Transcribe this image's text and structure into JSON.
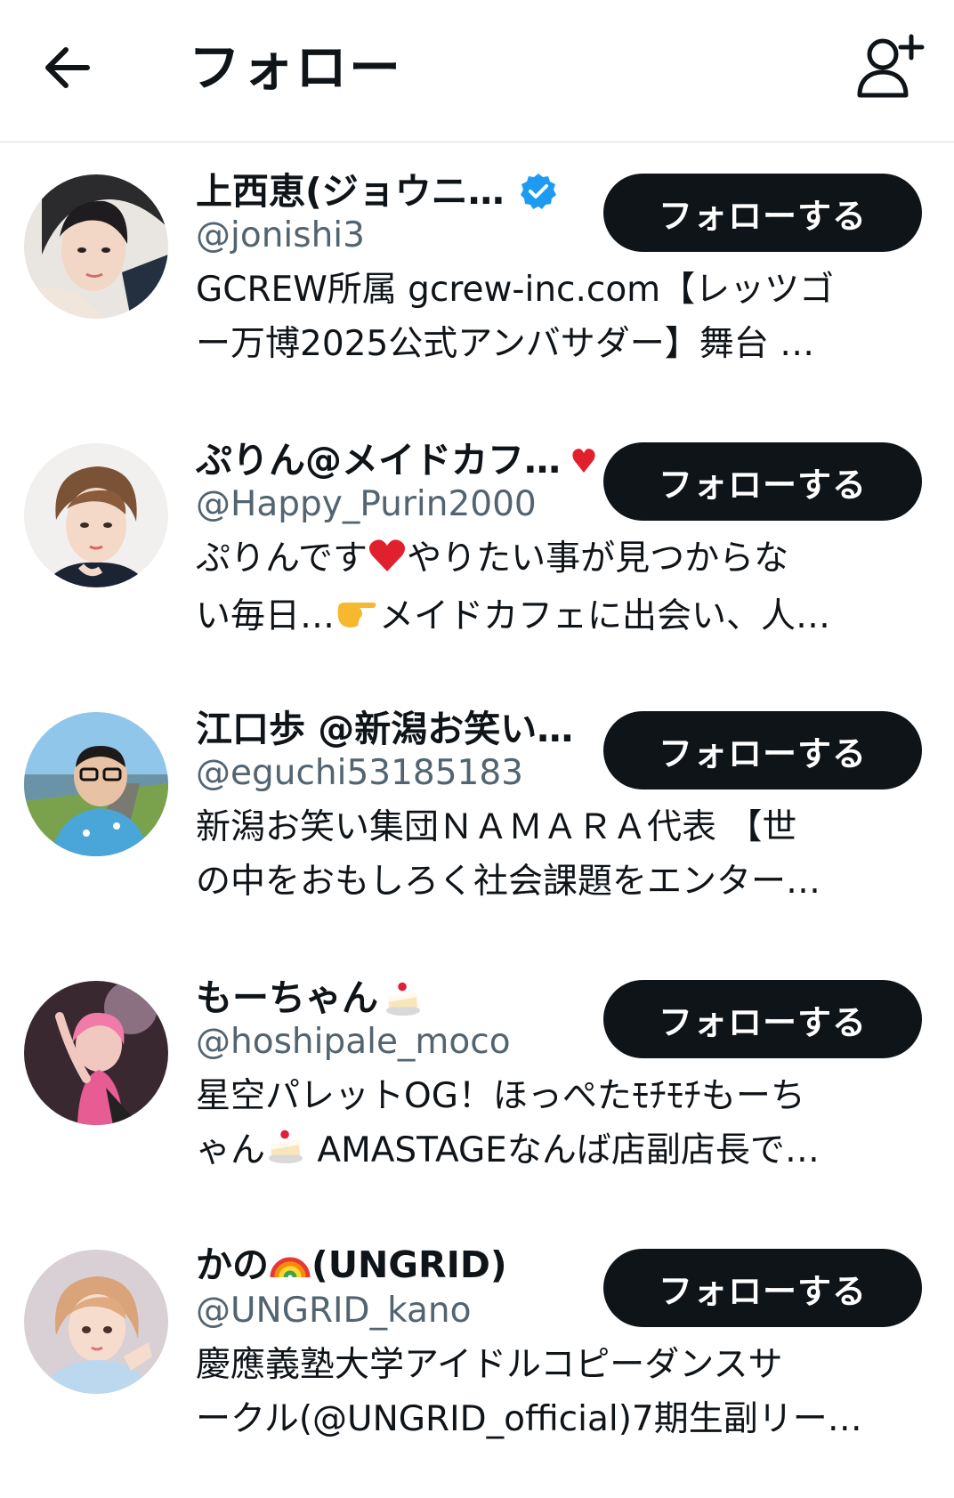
{
  "header": {
    "title": "フォロー",
    "back_icon": "arrow-left-icon",
    "add_user_icon": "person-add-icon"
  },
  "colors": {
    "text": "#0f1419",
    "secondary": "#536471",
    "button_bg": "#0f1419",
    "button_text": "#ffffff",
    "verified": "#1d9bf0",
    "divider": "#dcdcdc"
  },
  "users": [
    {
      "name": "上西恵(ジョウニ…",
      "verified": true,
      "handle": "@jonishi3",
      "bio_line1": "GCREW所属 gcrew-inc.com【レッツゴ",
      "bio_line2": "ー万博2025公式アンバサダー】舞台 …",
      "follow_label": "フォローする"
    },
    {
      "name": "ぷりん@メイドカフ…",
      "verified": false,
      "handle": "@Happy_Purin2000",
      "bio_line1a": "ぷりんです",
      "bio_line1b": "やりたい事が見つからな",
      "bio_line2a": "い毎日…",
      "bio_line2b": "メイドカフェに出会い、人…",
      "follow_label": "フォローする"
    },
    {
      "name": "江口歩 @新潟お笑い…",
      "verified": false,
      "handle": "@eguchi53185183",
      "bio_line1": "新潟お笑い集団ＮＡＭＡＲＡ代表 【世",
      "bio_line2": "の中をおもしろく社会課題をエンター…",
      "follow_label": "フォローする"
    },
    {
      "name": "もーちゃん",
      "verified": false,
      "handle": "@hoshipale_moco",
      "bio_line1": "星空パレットOG！ほっぺたﾓﾁﾓﾁもーち",
      "bio_line2a": "ゃん",
      "bio_line2b": " AMASTAGEなんば店副店長で…",
      "follow_label": "フォローする"
    },
    {
      "name_a": "かの",
      "name_b": "(UNGRID)",
      "verified": false,
      "handle": "@UNGRID_kano",
      "bio_line1": "慶應義塾大学アイドルコピーダンスサ",
      "bio_line2": "ークル(@UNGRID_official)7期生副リー…",
      "follow_label": "フォローする"
    }
  ]
}
